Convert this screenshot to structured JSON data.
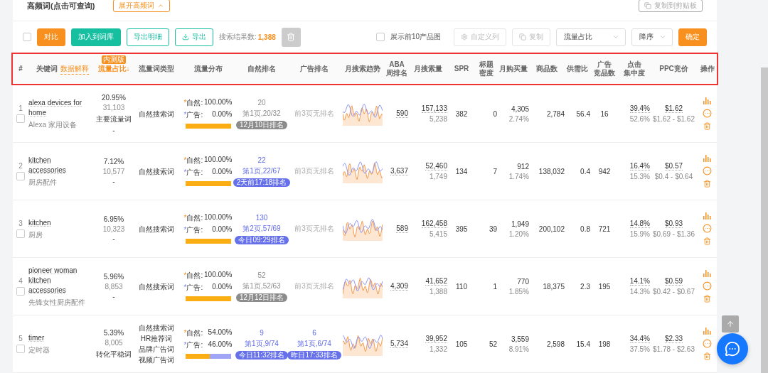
{
  "top_bar": {
    "title": "高频词(点击可查询)",
    "expand_button": "展开高频词",
    "copy_button": "复制到剪贴板"
  },
  "toolbar": {
    "select_all": {
      "checked": false
    },
    "compare": "对比",
    "add_to_library": "加入到词库",
    "export_detail": "导出明细",
    "export": "导出",
    "result_label": "搜索结果数:",
    "result_count": "1,388",
    "show_images": {
      "label": "展示前10产品图",
      "checked": false
    },
    "custom_columns": "自定义列",
    "copy": "复制",
    "sort_field": "流量占比",
    "sort_order": "降序",
    "confirm": "确定"
  },
  "columns": [
    {
      "label": "#"
    },
    {
      "label": "关键词",
      "link": "数据解释"
    },
    {
      "label": "流量占比↓",
      "badge": "内测版",
      "sorted": true
    },
    {
      "label": "流量词类型"
    },
    {
      "label": "流量分布"
    },
    {
      "label": "自然排名"
    },
    {
      "label": "广告排名"
    },
    {
      "label": "月搜索趋势"
    },
    {
      "label": [
        "ABA",
        "周排名"
      ]
    },
    {
      "label": "月搜索量"
    },
    {
      "label": "SPR"
    },
    {
      "label": [
        "标题",
        "密度"
      ]
    },
    {
      "label": "月购买量"
    },
    {
      "label": "商品数"
    },
    {
      "label": "供需比"
    },
    {
      "label": [
        "广告",
        "竞品数"
      ]
    },
    {
      "label": [
        "点击",
        "集中度"
      ]
    },
    {
      "label": "PPC竞价"
    },
    {
      "label": "操作"
    }
  ],
  "rows": [
    {
      "index": "1",
      "selected": false,
      "keyword": "alexa devices for home",
      "translation": "Alexa 家用设备",
      "share": "20.95%",
      "share_count": "31,103",
      "share_tag": "主要流量词",
      "share_extra": "-",
      "types": [
        "自然搜索词"
      ],
      "dist": {
        "natural_star": "*",
        "natural_label": "自然:",
        "natural": "100.00%",
        "ad_star": "*",
        "ad_label": "广告:",
        "ad": "0.00%",
        "level": 1
      },
      "natural_rank": {
        "kind": "ranked",
        "stale": true,
        "rank": "20",
        "page": "第1页,20/32",
        "badge": "12月10日排名"
      },
      "ad_rank": {
        "kind": "none",
        "text": "前3页无排名"
      },
      "aba": "590",
      "search": "157,133",
      "search_sub": "5,238",
      "spr": "382",
      "title_density": "0",
      "purchase": "4,305",
      "purchase_rate": "2.74%",
      "products": "2,784",
      "supply_ratio": "56.4",
      "ad_competitors": "16",
      "click": "39.4%",
      "click_sub": "52.6%",
      "ppc": "$1.62",
      "ppc_range": "$1.62 - $1.62"
    },
    {
      "index": "2",
      "selected": false,
      "keyword": "kitchen accessories",
      "translation": "厨房配件",
      "share": "7.12%",
      "share_count": "10,577",
      "share_extra": "-",
      "types": [
        "自然搜索词"
      ],
      "dist": {
        "natural_star": "*",
        "natural_label": "自然:",
        "natural": "100.00%",
        "ad_star": "*",
        "ad_label": "广告:",
        "ad": "0.00%",
        "level": 1
      },
      "natural_rank": {
        "kind": "ranked",
        "stale": false,
        "rank": "22",
        "page": "第1页,22/67",
        "badge": "2天前17:18排名"
      },
      "ad_rank": {
        "kind": "none",
        "text": "前3页无排名"
      },
      "aba": "3,637",
      "search": "52,460",
      "search_sub": "1,749",
      "spr": "134",
      "title_density": "7",
      "purchase": "912",
      "purchase_rate": "1.74%",
      "products": "138,032",
      "supply_ratio": "0.4",
      "ad_competitors": "942",
      "click": "16.4%",
      "click_sub": "15.3%",
      "ppc": "$0.57",
      "ppc_range": "$0.4 - $0.64"
    },
    {
      "index": "3",
      "selected": false,
      "keyword": "kitchen",
      "translation": "厨房",
      "share": "6.95%",
      "share_count": "10,323",
      "share_extra": "-",
      "types": [
        "自然搜索词"
      ],
      "dist": {
        "natural_star": "*",
        "natural_label": "自然:",
        "natural": "100.00%",
        "ad_star": "*",
        "ad_label": "广告:",
        "ad": "0.00%",
        "level": 1
      },
      "natural_rank": {
        "kind": "ranked",
        "stale": false,
        "rank": "130",
        "page": "第2页,57/69",
        "badge": "今日09:29排名"
      },
      "ad_rank": {
        "kind": "none",
        "text": "前3页无排名"
      },
      "aba": "589",
      "search": "162,458",
      "search_sub": "5,415",
      "spr": "395",
      "title_density": "39",
      "purchase": "1,949",
      "purchase_rate": "1.20%",
      "products": "200,102",
      "supply_ratio": "0.8",
      "ad_competitors": "721",
      "click": "14.8%",
      "click_sub": "15.9%",
      "ppc": "$0.93",
      "ppc_range": "$0.69 - $1.36"
    },
    {
      "index": "4",
      "selected": false,
      "keyword": "pioneer woman kitchen accessories",
      "translation": "先锋女性厨房配件",
      "share": "5.96%",
      "share_count": "8,853",
      "share_extra": "-",
      "types": [
        "自然搜索词"
      ],
      "dist": {
        "natural_star": "*",
        "natural_label": "自然:",
        "natural": "100.00%",
        "ad_star": "*",
        "ad_label": "广告:",
        "ad": "0.00%",
        "level": 1
      },
      "natural_rank": {
        "kind": "ranked",
        "stale": true,
        "rank": "52",
        "page": "第1页,52/63",
        "badge": "12月12日排名"
      },
      "ad_rank": {
        "kind": "none",
        "text": "前3页无排名"
      },
      "aba": "4,309",
      "search": "41,652",
      "search_sub": "1,388",
      "spr": "110",
      "title_density": "1",
      "purchase": "770",
      "purchase_rate": "1.85%",
      "products": "18,375",
      "supply_ratio": "2.3",
      "ad_competitors": "195",
      "click": "14.1%",
      "click_sub": "14.3%",
      "ppc": "$0.59",
      "ppc_range": "$0.42 - $0.67"
    },
    {
      "index": "5",
      "selected": false,
      "keyword": "timer",
      "translation": "定时器",
      "share": "5.39%",
      "share_count": "8,005",
      "share_tag": "转化平稳词",
      "types": [
        "自然搜索词",
        "HR推荐词",
        "品牌广告词",
        "视频广告词"
      ],
      "dist": {
        "natural_star": "*",
        "natural_label": "自然:",
        "natural": "54.00%",
        "ad_star": "*",
        "ad_label": "广告:",
        "ad": "46.00%",
        "level": 0.54
      },
      "natural_rank": {
        "kind": "ranked",
        "stale": false,
        "rank": "9",
        "page": "第1页,9/74",
        "badge": "今日11:32排名"
      },
      "ad_rank": {
        "kind": "ranked",
        "stale": false,
        "rank": "6",
        "page": "第1页,6/74",
        "badge": "昨日17:33排名"
      },
      "aba": "5,734",
      "search": "39,952",
      "search_sub": "1,332",
      "spr": "105",
      "title_density": "52",
      "purchase": "3,559",
      "purchase_rate": "8.91%",
      "products": "2,598",
      "supply_ratio": "15.4",
      "ad_competitors": "198",
      "click": "34.4%",
      "click_sub": "37.5%",
      "ppc": "$2.33",
      "ppc_range": "$1.78 - $2.63"
    }
  ]
}
